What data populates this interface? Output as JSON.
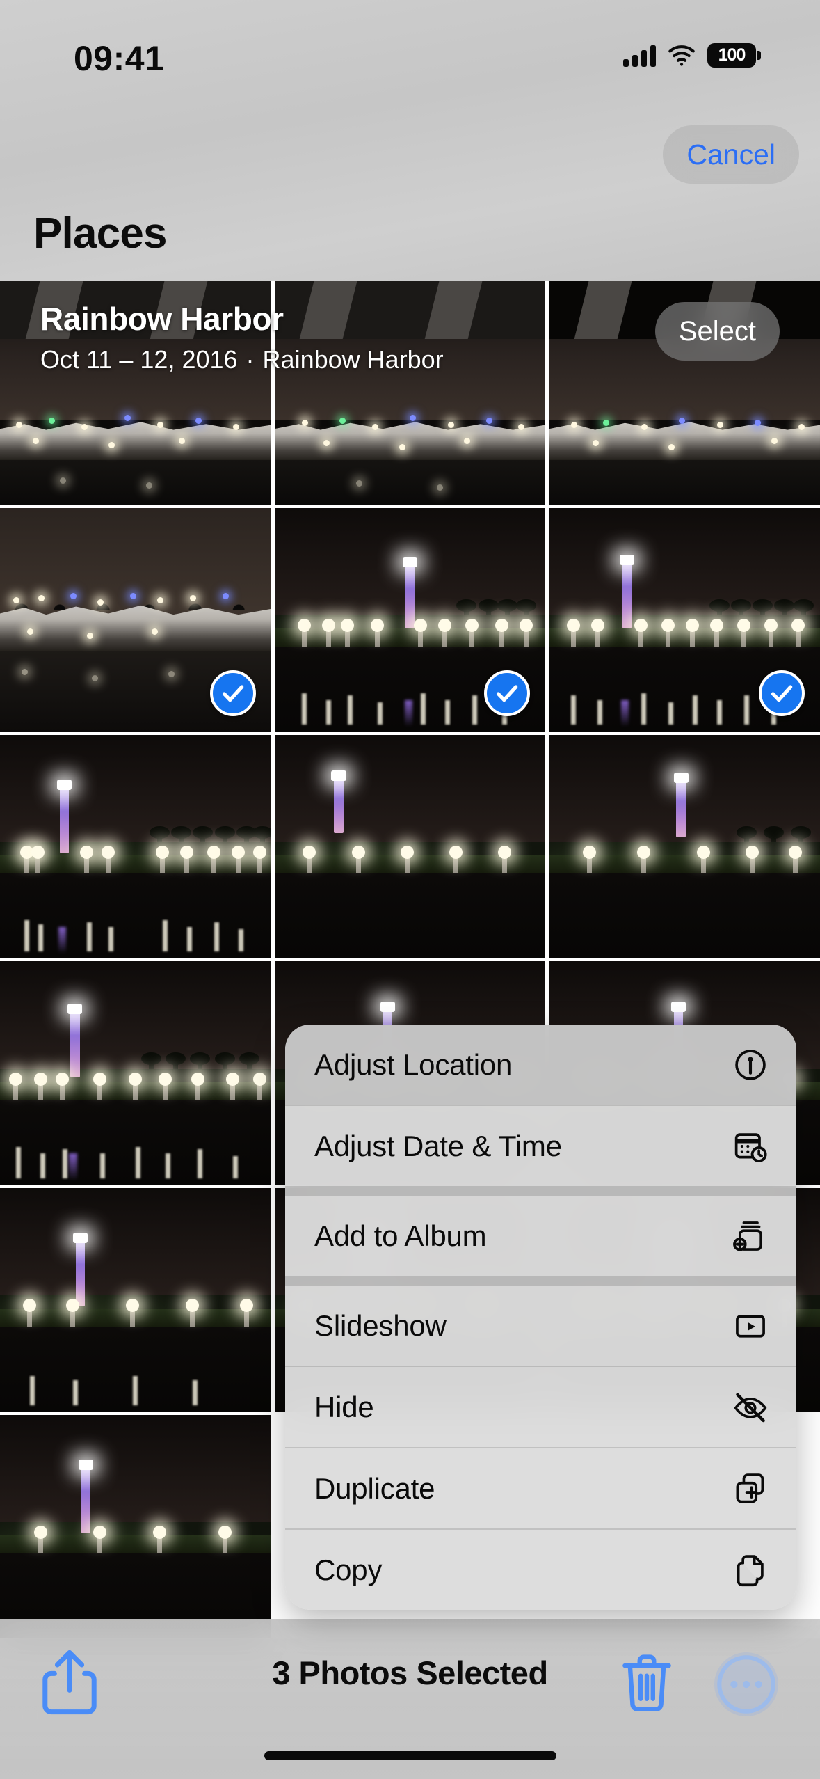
{
  "status_bar": {
    "time": "09:41",
    "battery_percent": "100",
    "icons": [
      "cellular-signal-icon",
      "wifi-icon",
      "battery-icon"
    ]
  },
  "nav": {
    "cancel_label": "Cancel",
    "page_title": "Places"
  },
  "grid_header": {
    "title": "Rainbow Harbor",
    "date_range": "Oct 11 – 12, 2016",
    "separator": "·",
    "place": "Rainbow Harbor",
    "select_label": "Select"
  },
  "grid": {
    "columns": 3,
    "photos": [
      {
        "scene": "marina",
        "selected": false
      },
      {
        "scene": "marina",
        "selected": false
      },
      {
        "scene": "marina",
        "selected": false
      },
      {
        "scene": "marina-wide",
        "selected": true
      },
      {
        "scene": "lighthouse",
        "selected": true
      },
      {
        "scene": "lighthouse",
        "selected": true
      },
      {
        "scene": "lighthouse",
        "selected": false
      },
      {
        "scene": "lighthouse",
        "selected": false
      },
      {
        "scene": "lighthouse",
        "selected": false
      },
      {
        "scene": "lighthouse",
        "selected": false
      },
      {
        "scene": "lighthouse",
        "selected": false
      },
      {
        "scene": "lighthouse",
        "selected": false
      },
      {
        "scene": "lighthouse",
        "selected": false
      },
      {
        "scene": "lighthouse",
        "selected": false
      },
      {
        "scene": "lighthouse",
        "selected": false
      }
    ]
  },
  "context_menu": {
    "groups": [
      {
        "items": [
          {
            "label": "Adjust Location",
            "icon": "location-pin-circle-icon",
            "highlighted": true
          },
          {
            "label": "Adjust Date & Time",
            "icon": "calendar-clock-icon",
            "highlighted": false
          }
        ]
      },
      {
        "items": [
          {
            "label": "Add to Album",
            "icon": "rectangle-stack-plus-icon",
            "highlighted": false
          }
        ]
      },
      {
        "items": [
          {
            "label": "Slideshow",
            "icon": "play-rectangle-icon",
            "highlighted": false
          },
          {
            "label": "Hide",
            "icon": "eye-slash-icon",
            "highlighted": false
          },
          {
            "label": "Duplicate",
            "icon": "plus-square-on-square-icon",
            "highlighted": false
          },
          {
            "label": "Copy",
            "icon": "doc-on-doc-icon",
            "highlighted": false
          }
        ]
      }
    ]
  },
  "bottom_bar": {
    "share_icon": "share-up-arrow-icon",
    "selected_count_label": "3 Photos Selected",
    "trash_icon": "trash-icon",
    "more_icon": "ellipsis-circle-icon"
  },
  "colors": {
    "accent_blue": "#2b6ef5",
    "selection_blue": "#1675f0",
    "toolbar_blue": "#4a8cf7",
    "menu_bg": "#d8d8d8",
    "chrome_bg": "#c9c9c9"
  }
}
